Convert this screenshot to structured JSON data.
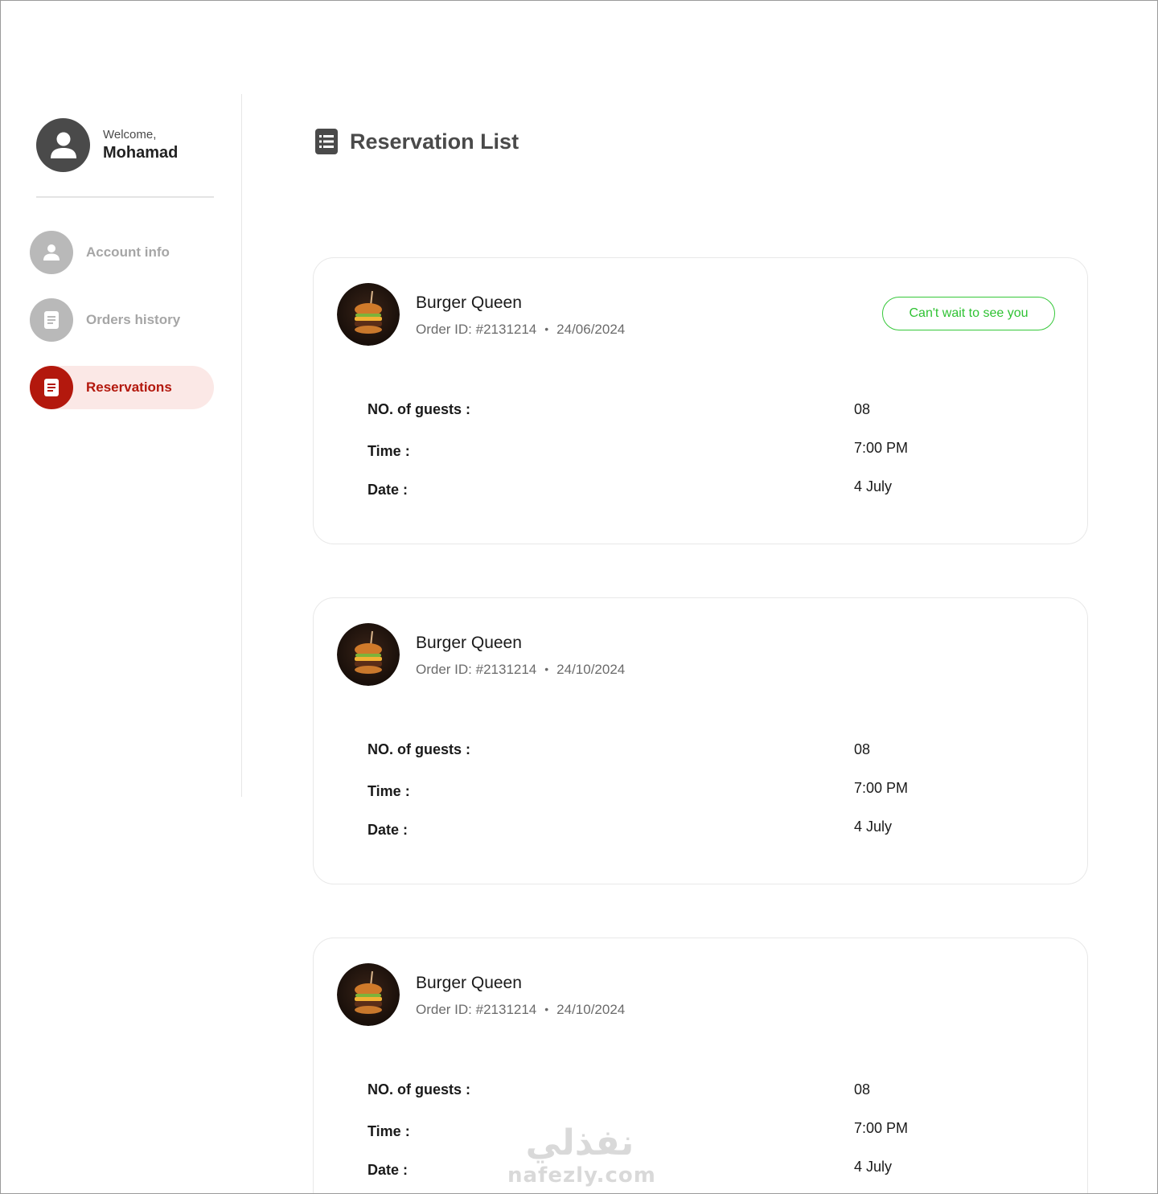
{
  "sidebar": {
    "welcome": "Welcome,",
    "username": "Mohamad",
    "items": [
      {
        "label": "Account info",
        "icon": "user-icon",
        "active": false
      },
      {
        "label": "Orders history",
        "icon": "document-icon",
        "active": false
      },
      {
        "label": "Reservations",
        "icon": "document-icon",
        "active": true
      }
    ]
  },
  "main": {
    "title": "Reservation List",
    "cards": [
      {
        "restaurant": "Burger Queen",
        "order_id": "Order ID: #2131214",
        "date": "24/06/2024",
        "status": "Can't wait to see you",
        "guests_label": "NO. of guests :",
        "guests": "08",
        "time_label": "Time :",
        "time": "7:00 PM",
        "date_label": "Date :",
        "res_date": "4 July"
      },
      {
        "restaurant": "Burger Queen",
        "order_id": "Order ID: #2131214",
        "date": "24/10/2024",
        "guests_label": "NO. of guests :",
        "guests": "08",
        "time_label": "Time :",
        "time": "7:00 PM",
        "date_label": "Date :",
        "res_date": "4 July"
      },
      {
        "restaurant": "Burger Queen",
        "order_id": "Order ID: #2131214",
        "date": "24/10/2024",
        "guests_label": "NO. of guests :",
        "guests": "08",
        "time_label": "Time :",
        "time": "7:00 PM",
        "date_label": "Date :",
        "res_date": "4 July"
      }
    ]
  },
  "watermark": {
    "arabic": "نفذلي",
    "latin": "nafezly.com"
  },
  "colors": {
    "accent": "#b3180d",
    "accent_bg": "#fbe8e6",
    "status_green": "#2fc233"
  }
}
